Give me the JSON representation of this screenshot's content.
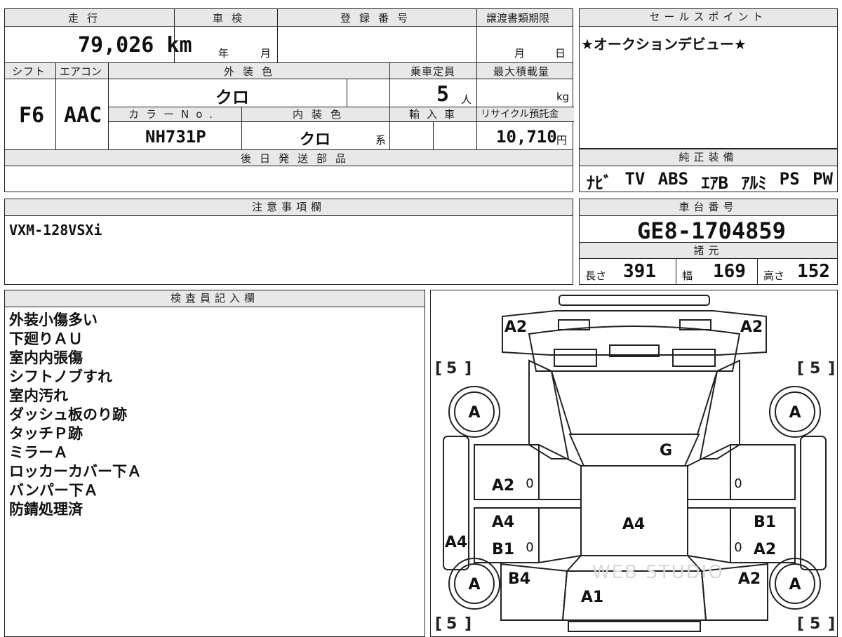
{
  "vehicle": {
    "mileage_label": "走行",
    "mileage": "79,026 km",
    "shaken_label": "車検",
    "shaken_year_unit": "年",
    "shaken_month_unit": "月",
    "registration_label": "登録番号",
    "transfer_deadline_label": "譲渡書類期限",
    "transfer_month_unit": "月",
    "transfer_day_unit": "日",
    "shift_label": "シフト",
    "shift": "F6",
    "aircon_label": "エアコン",
    "aircon": "AAC",
    "exterior_color_label": "外装色",
    "exterior_color": "クロ",
    "capacity_label": "乗車定員",
    "capacity": "5",
    "capacity_unit": "人",
    "max_load_label": "最大積載量",
    "max_load_unit": "kg",
    "color_no_label": "カラーNo.",
    "color_no": "NH731P",
    "interior_color_label": "内装色",
    "interior_color": "クロ",
    "interior_color_suffix": "系",
    "import_label": "輸入車",
    "recycle_label": "リサイクル預託金",
    "recycle_fee": "10,710",
    "recycle_unit": "円",
    "later_parts_label": "後日発送部品",
    "later_parts": ""
  },
  "sales_point": {
    "label": "セールスポイント",
    "text": "★オークションデビュー★"
  },
  "equipment": {
    "label": "純正装備",
    "items": [
      "ﾅﾋﾞ",
      "TV",
      "ABS",
      "ｴｱB",
      "ｱﾙﾐ",
      "PS",
      "PW"
    ]
  },
  "caution": {
    "label": "注意事項欄",
    "text": "VXM-128VSXi"
  },
  "chassis": {
    "label": "車台番号",
    "number": "GE8-1704859"
  },
  "specs": {
    "label": "諸元",
    "length_label": "長さ",
    "length": "391",
    "width_label": "幅",
    "width": "169",
    "height_label": "高さ",
    "height": "152"
  },
  "inspector": {
    "label": "検査員記入欄",
    "notes": [
      "外装小傷多い",
      "下廻りＡＵ",
      "室内内張傷",
      "シフトノブすれ",
      "室内汚れ",
      "ダッシュ板のり跡",
      "タッチＰ跡",
      "ミラーＡ",
      "ロッカーカバー下Ａ",
      "バンパー下Ａ",
      "防錆処理済"
    ]
  },
  "diagram": {
    "tire_tread_fl": "5",
    "tire_tread_fr": "5",
    "tire_tread_rl": "5",
    "tire_tread_rr": "5",
    "wheel_fl": "A",
    "wheel_fr": "A",
    "wheel_rl": "A",
    "wheel_rr": "A",
    "front_left_corner": "A2",
    "front_right_corner": "A2",
    "windshield": "G",
    "left_front_door": "A2",
    "left_front_door_zero": "0",
    "right_front_door_zero": "0",
    "roof": "A4",
    "left_rear_door_1": "A4",
    "left_rear_door_2": "B1",
    "left_rear_door_zero": "0",
    "right_rear_door_1": "B1",
    "right_rear_door_2": "A2",
    "right_rear_door_zero": "0",
    "left_rocker": "A4",
    "left_rear_fender": "B4",
    "right_rear_fender": "A2",
    "rear_gate": "A1",
    "watermark": "WEB STUDIO"
  }
}
